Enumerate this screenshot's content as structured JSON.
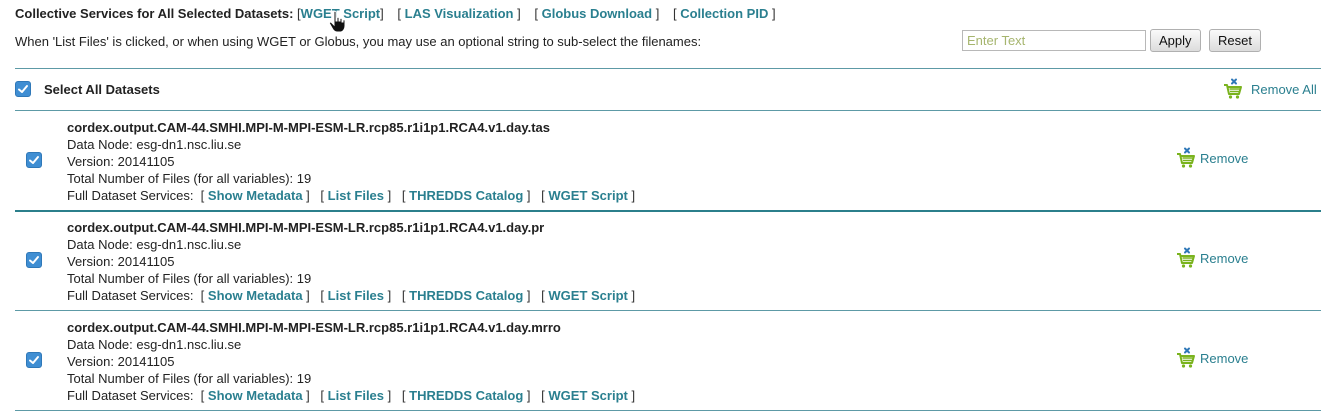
{
  "header": {
    "label": "Collective Services for All Selected Datasets:",
    "links": [
      "WGET Script",
      "LAS Visualization",
      "Globus Download",
      "Collection PID"
    ]
  },
  "instructions": "When 'List Files' is clicked, or when using WGET or Globus, you may use an optional string to sub-select the filenames:",
  "filter": {
    "placeholder": "Enter Text",
    "value": "",
    "apply_label": "Apply",
    "reset_label": "Reset"
  },
  "select_all": {
    "label": "Select All Datasets",
    "checked": true,
    "remove_all_label": "Remove All"
  },
  "labels": {
    "data_node": "Data Node:",
    "version": "Version:",
    "total_files": "Total Number of Files (for all variables):",
    "full_services": "Full Dataset Services:",
    "remove": "Remove"
  },
  "service_links": [
    "Show Metadata",
    "List Files",
    "THREDDS Catalog",
    "WGET Script"
  ],
  "datasets": [
    {
      "id": "cordex.output.CAM-44.SMHI.MPI-M-MPI-ESM-LR.rcp85.r1i1p1.RCA4.v1.day.tas",
      "data_node": "esg-dn1.nsc.liu.se",
      "version": "20141105",
      "total_files": "19",
      "checked": true
    },
    {
      "id": "cordex.output.CAM-44.SMHI.MPI-M-MPI-ESM-LR.rcp85.r1i1p1.RCA4.v1.day.pr",
      "data_node": "esg-dn1.nsc.liu.se",
      "version": "20141105",
      "total_files": "19",
      "checked": true
    },
    {
      "id": "cordex.output.CAM-44.SMHI.MPI-M-MPI-ESM-LR.rcp85.r1i1p1.RCA4.v1.day.mrro",
      "data_node": "esg-dn1.nsc.liu.se",
      "version": "20141105",
      "total_files": "19",
      "checked": true
    }
  ],
  "icons": {
    "remove": "cart-remove-icon",
    "checkbox": "checkmark-icon",
    "pointer": "hand-pointer-icon"
  },
  "colors": {
    "link": "#2a7f8f",
    "divider": "#2b7f8b",
    "checkbox": "#3f8ed3",
    "cart": "#7ab31e",
    "cart_x": "#2f78b8"
  }
}
